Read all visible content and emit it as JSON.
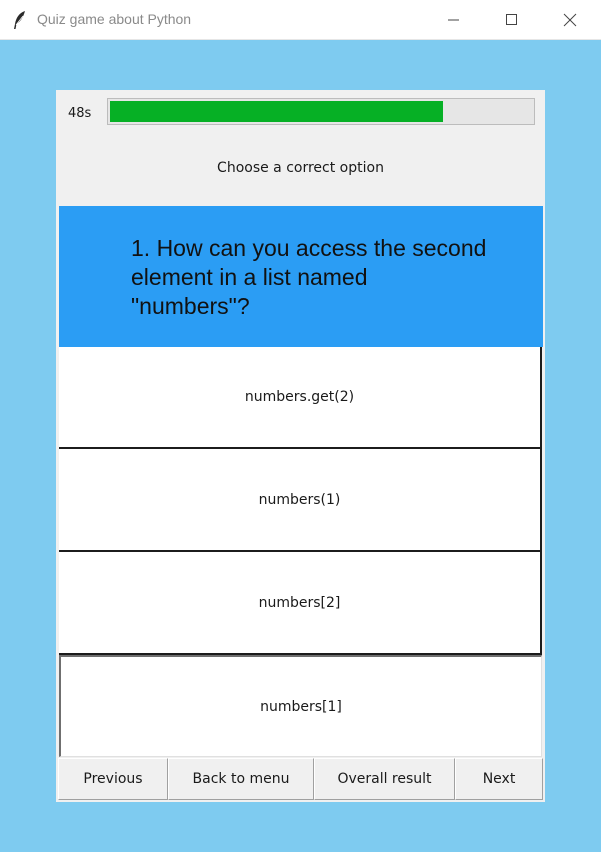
{
  "window": {
    "title": "Quiz game about Python",
    "icon": "feather-icon",
    "controls": [
      "minimize-icon",
      "maximize-icon",
      "close-icon"
    ]
  },
  "timer": {
    "label": "48s",
    "progress_fraction": 0.79,
    "bar_color": "#06b025"
  },
  "instruction": "Choose a correct option",
  "question": {
    "text": "1. How can you access the second element in a list named \"numbers\"?",
    "background": "#2b9df4"
  },
  "options": [
    {
      "label": "numbers.get(2)"
    },
    {
      "label": "numbers(1)"
    },
    {
      "label": "numbers[2]"
    },
    {
      "label": "numbers[1]"
    }
  ],
  "nav": {
    "previous": "Previous",
    "back_to_menu": "Back to menu",
    "overall_result": "Overall result",
    "next": "Next"
  },
  "colors": {
    "window_background": "#7ecbf0",
    "panel_background": "#f0f0f0"
  }
}
